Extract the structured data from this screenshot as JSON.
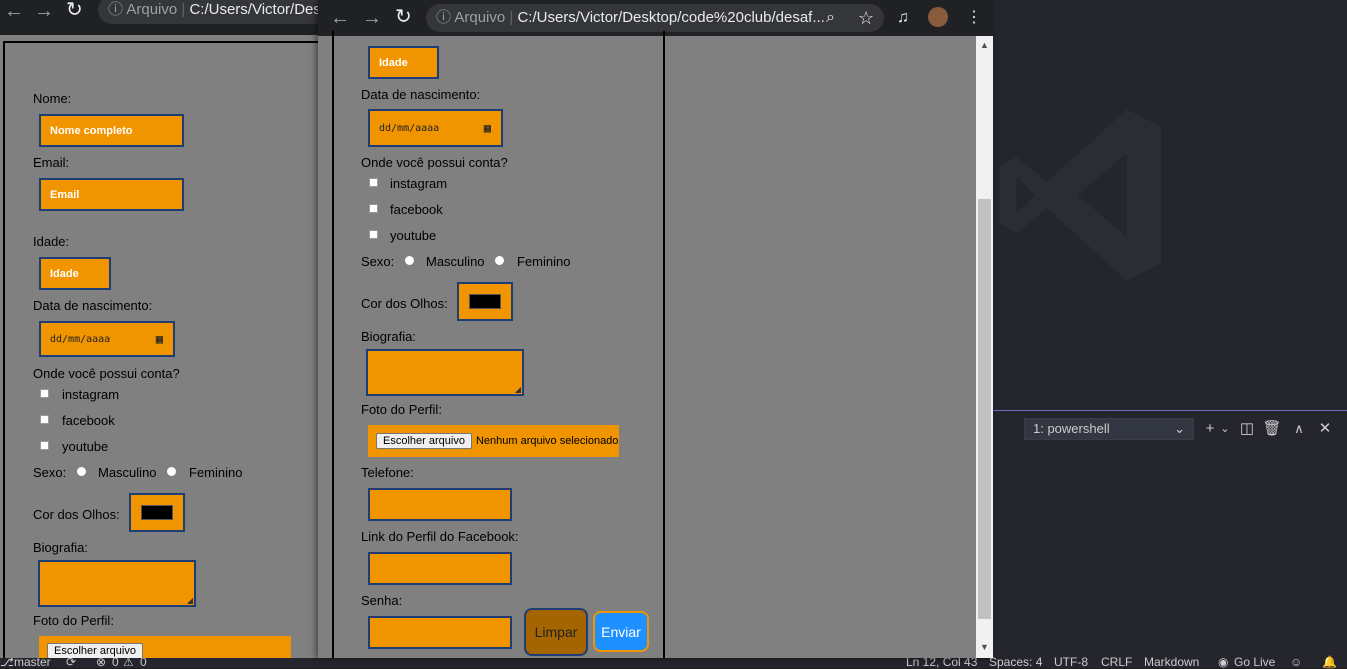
{
  "vscode": {
    "terminal": {
      "selected": "1: powershell"
    },
    "statusbar": {
      "branch": "master",
      "errors": "0",
      "warnings": "0",
      "position": "Ln 12, Col 43",
      "spaces": "Spaces: 4",
      "encoding": "UTF-8",
      "eol": "CRLF",
      "language": "Markdown",
      "golive": "Go Live"
    }
  },
  "browser_back": {
    "omnibox_label": "Arquivo",
    "url": "C:/Users/Victor/Des"
  },
  "browser_front": {
    "omnibox_label": "Arquivo",
    "url": "C:/Users/Victor/Desktop/code%20club/desaf..."
  },
  "form": {
    "nome_label": "Nome:",
    "nome_placeholder": "Nome completo",
    "email_label": "Email:",
    "email_placeholder": "Email",
    "idade_label": "Idade:",
    "idade_placeholder": "Idade",
    "nascimento_label": "Data de nascimento:",
    "date_placeholder": "dd/mm/aaaa",
    "conta_label": "Onde você possui conta?",
    "contas": [
      "instagram",
      "facebook",
      "youtube"
    ],
    "sexo_label": "Sexo:",
    "sexo_masculino": "Masculino",
    "sexo_feminino": "Feminino",
    "olhos_label": "Cor dos Olhos:",
    "olhos_color": "#000000",
    "bio_label": "Biografia:",
    "foto_label": "Foto do Perfil:",
    "file_button": "Escolher arquivo",
    "file_status": "Nenhum arquivo selecionado",
    "telefone_label": "Telefone:",
    "facebook_label": "Link do Perfil do Facebook:",
    "senha_label": "Senha:",
    "limpar": "Limpar",
    "enviar": "Enviar"
  },
  "colors": {
    "field_bg": "#f09500",
    "field_border": "#1f3d75",
    "page_bg": "#808080",
    "enviar_bg": "#1e90ff",
    "limpar_bg": "#a46400"
  }
}
